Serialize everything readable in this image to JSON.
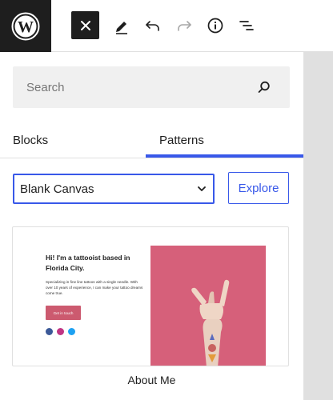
{
  "toolbar": {
    "logo_icon": "wordpress-logo-icon",
    "close_icon": "close-icon",
    "edit_icon": "pencil-icon",
    "undo_icon": "undo-icon",
    "redo_icon": "redo-icon",
    "info_icon": "info-icon",
    "outline_icon": "list-view-icon"
  },
  "inserter": {
    "search_placeholder": "Search",
    "tabs": [
      {
        "label": "Blocks",
        "active": false
      },
      {
        "label": "Patterns",
        "active": true
      }
    ],
    "category_select": {
      "value": "Blank Canvas"
    },
    "explore_label": "Explore",
    "pattern": {
      "preview": {
        "heading": "Hi! I'm a tattooist based in Florida City.",
        "body": "Specializing in fine line tattoos with a single needle. With over 10 years of experience, I can make your tattoo dreams come true.",
        "button": "Get in touch",
        "social_icons": [
          "facebook-icon",
          "instagram-icon",
          "twitter-icon"
        ]
      },
      "label": "About Me"
    }
  },
  "colors": {
    "accent": "#3858e9",
    "toolbar_dark": "#1e1e1e",
    "preview_pink": "#d6607a",
    "preview_button": "#cc5a6f"
  }
}
